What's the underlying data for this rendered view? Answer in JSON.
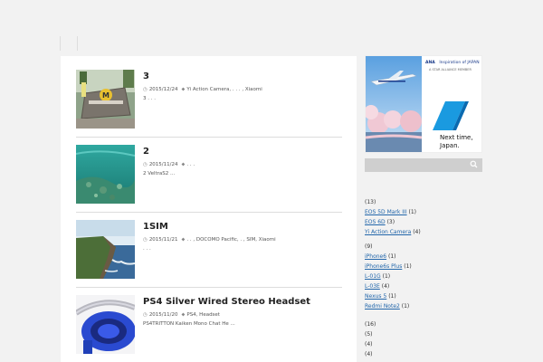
{
  "posts": [
    {
      "title": "3",
      "date": "2015/12/24",
      "tags": "Yi Action Camera, . . . , Xiaomi",
      "excerpt": "3 . . ."
    },
    {
      "title": "2",
      "date": "2015/11/24",
      "tags": ". . .",
      "excerpt": "2 VeltraS2 ..."
    },
    {
      "title": "1SIM",
      "date": "2015/11/21",
      "tags": ". . , DOCOMO Pacific, . , SIM, Xiaomi",
      "excerpt": ". . ."
    },
    {
      "title": "PS4 Silver Wired Stereo Headset",
      "date": "2015/11/20",
      "tags": "PS4, Headset",
      "excerpt": "PS4TRITTON Kaiken Mono Chat He ..."
    }
  ],
  "ad": {
    "brand": "ANA",
    "tagline": "Inspiration of JAPAN",
    "member": "A STAR ALLIANCE MEMBER",
    "headline_1": "Next time,",
    "headline_2": "Japan."
  },
  "sidebar": {
    "groups": [
      {
        "count": "(13)",
        "items": [
          {
            "label": "EOS 5D Mark III",
            "count": "(1)"
          },
          {
            "label": "EOS 6D",
            "count": "(3)"
          },
          {
            "label": "Yi Action Camera",
            "count": "(4)"
          }
        ]
      },
      {
        "count": "(9)",
        "items": [
          {
            "label": "iPhone6",
            "count": "(1)"
          },
          {
            "label": "iPhone6s Plus",
            "count": "(1)"
          },
          {
            "label": "L-01G",
            "count": "(1)"
          },
          {
            "label": "L-03E",
            "count": "(4)"
          },
          {
            "label": "Nexus 5",
            "count": "(1)"
          },
          {
            "label": "Redmi Note2",
            "count": "(1)"
          }
        ]
      }
    ],
    "trailing_counts": [
      "(16)",
      "(5)",
      "(4)",
      "(4)"
    ]
  },
  "colors": {
    "background": "#f2f2f2",
    "link": "#2266aa",
    "search_bar": "#cfcfcf"
  },
  "icons": {
    "date": "clock-icon",
    "tag": "tag-icon",
    "search": "search-icon"
  }
}
